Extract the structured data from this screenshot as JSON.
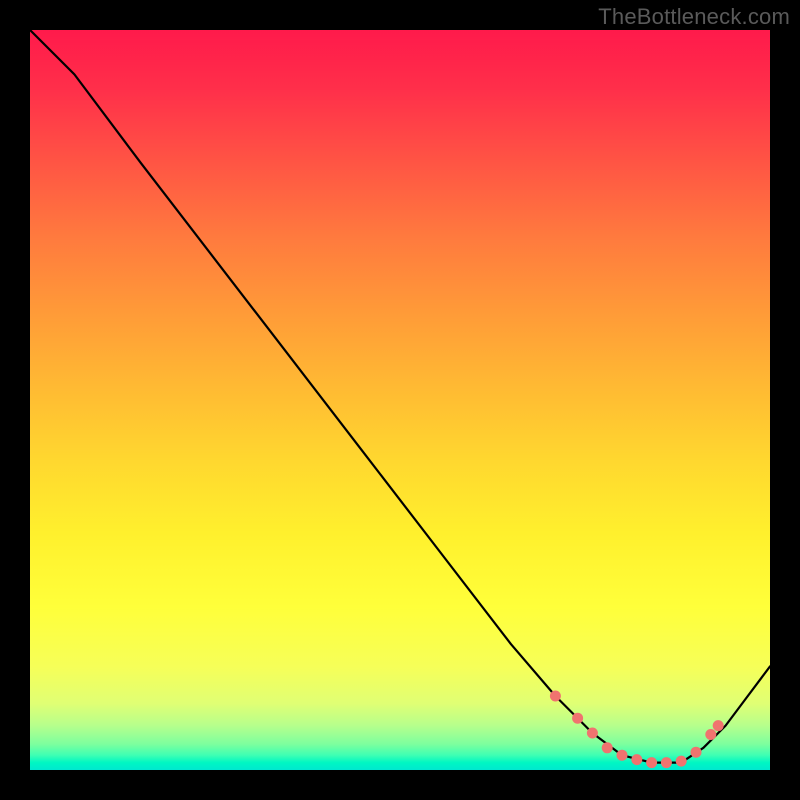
{
  "watermark": "TheBottleneck.com",
  "colors": {
    "background": "#000000",
    "curve": "#000000",
    "marker": "#f0736f"
  },
  "chart_data": {
    "type": "line",
    "title": "",
    "xlabel": "",
    "ylabel": "",
    "xlim": [
      0,
      100
    ],
    "ylim": [
      0,
      100
    ],
    "legend": false,
    "grid": false,
    "description": "Bottleneck-style V-curve over a vertical red→green heat gradient. The curve falls from top-left, reaches a flat minimum near the bottom at roughly x≈78–88, then rises toward the right edge. Salmon markers highlight the flat minimum region.",
    "series": [
      {
        "name": "curve",
        "x": [
          0,
          6,
          15,
          25,
          35,
          45,
          55,
          65,
          71,
          76,
          80,
          84,
          88,
          91,
          94,
          97,
          100
        ],
        "y": [
          100,
          94,
          82,
          69,
          56,
          43,
          30,
          17,
          10,
          5,
          2,
          1,
          1,
          3,
          6,
          10,
          14
        ]
      }
    ],
    "markers": {
      "name": "minimum-band",
      "x": [
        71,
        74,
        76,
        78,
        80,
        82,
        84,
        86,
        88,
        90,
        92,
        93
      ],
      "y": [
        10,
        7,
        5,
        3,
        2,
        1.4,
        1,
        1,
        1.2,
        2.4,
        4.8,
        6
      ]
    }
  }
}
